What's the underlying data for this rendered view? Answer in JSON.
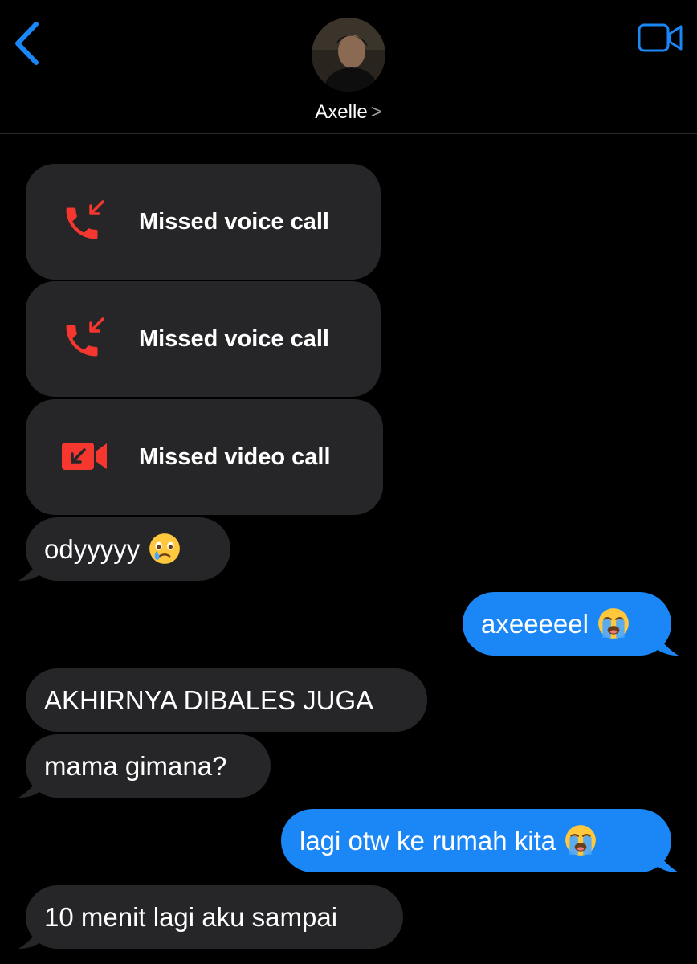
{
  "header": {
    "contact_name": "Axelle",
    "name_chevron": ">"
  },
  "colors": {
    "accent": "#1b87f7",
    "missed_red": "#f5372f",
    "incoming_bubble": "#262628",
    "background": "#000000"
  },
  "calls": [
    {
      "label": "Missed voice call",
      "icon": "missed-voice-call-icon"
    },
    {
      "label": "Missed voice call",
      "icon": "missed-voice-call-icon"
    },
    {
      "label": "Missed video call",
      "icon": "missed-video-call-icon"
    }
  ],
  "messages": [
    {
      "direction": "incoming",
      "text": "odyyyyy",
      "emoji": "face-holding-back-tears"
    },
    {
      "direction": "outgoing",
      "text": "axeeeeel",
      "emoji": "loudly-crying-face"
    },
    {
      "direction": "incoming",
      "text": "AKHIRNYA DIBALES JUGA"
    },
    {
      "direction": "incoming",
      "text": "mama gimana?"
    },
    {
      "direction": "outgoing",
      "text": "lagi otw ke rumah kita",
      "emoji": "loudly-crying-face"
    },
    {
      "direction": "incoming",
      "text": "10 menit lagi aku sampai"
    }
  ]
}
